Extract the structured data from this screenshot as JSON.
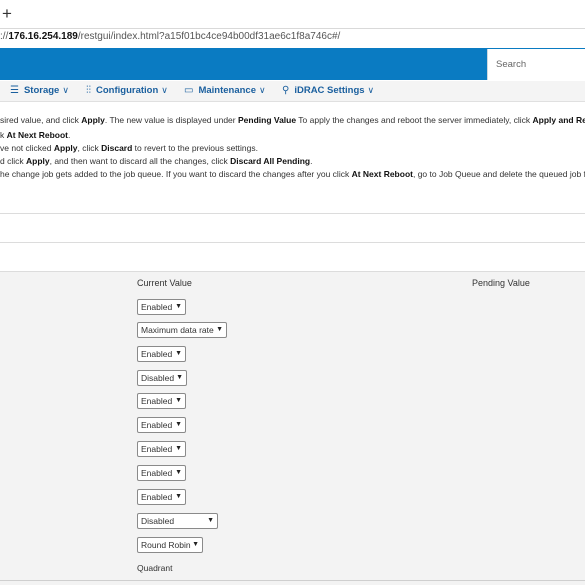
{
  "browser": {
    "new_tab_label": "+",
    "url_prefix": "://",
    "url_host": "176.16.254.189",
    "url_path": "/restgui/index.html?a15f01bc4ce94b00df31ae6c1f8a746c#/"
  },
  "header": {
    "search_placeholder": "Search"
  },
  "nav": {
    "items": [
      {
        "label": "Storage",
        "icon": "storage-icon",
        "chev": "∨"
      },
      {
        "label": "Configuration",
        "icon": "sliders-icon",
        "chev": "∨"
      },
      {
        "label": "Maintenance",
        "icon": "maintenance-icon",
        "chev": "∨"
      },
      {
        "label": "iDRAC Settings",
        "icon": "key-icon",
        "chev": "∨"
      }
    ]
  },
  "help": {
    "l1a": "sired value, and click ",
    "l1b": "Apply",
    "l1c": ". The new value is displayed under ",
    "l1d": "Pending Value",
    "l1e": " To apply the changes and reboot the server immediately, click ",
    "l1f": "Apply and Reboot",
    "l2a": "k ",
    "l2b": "At Next Reboot",
    "l2c": ".",
    "l3a": "ve not clicked ",
    "l3b": "Apply",
    "l3c": ", click ",
    "l3d": "Discard",
    "l3e": " to revert to the previous settings.",
    "l4a": "d click ",
    "l4b": "Apply",
    "l4c": ", and then want to discard all the changes, click ",
    "l4d": "Discard All Pending",
    "l4e": ".",
    "l5a": "he change job gets added to the job queue. If you want to discard the changes after you click ",
    "l5b": "At Next Reboot",
    "l5c": ", go to Job Queue and delete the queued job for"
  },
  "table": {
    "col_current": "Current Value",
    "col_pending": "Pending Value",
    "rows": [
      {
        "value": "Enabled"
      },
      {
        "value": "Maximum data rate"
      },
      {
        "value": "Enabled"
      },
      {
        "value": "Disabled"
      },
      {
        "value": "Enabled"
      },
      {
        "value": "Enabled"
      },
      {
        "value": "Enabled"
      },
      {
        "value": "Enabled"
      },
      {
        "value": "Enabled"
      },
      {
        "value": "Disabled"
      },
      {
        "value": "Round Robin"
      },
      {
        "value": "Quadrant"
      }
    ]
  },
  "colors": {
    "appbar": "#0a7bc2",
    "nav_text": "#1a5f9e",
    "table_bg": "#f3f3f3"
  }
}
